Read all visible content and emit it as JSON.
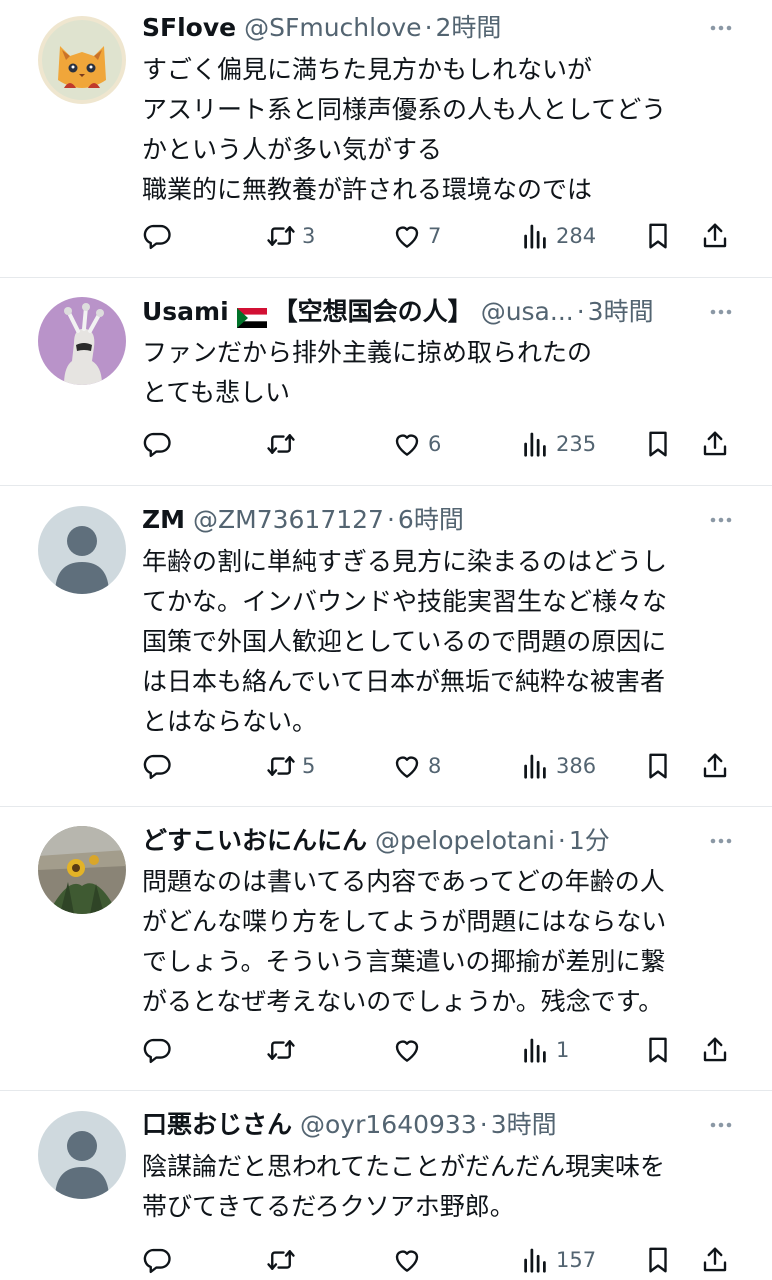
{
  "tweets": [
    {
      "name": "SFlove",
      "handle": "@SFmuchlove",
      "time": "2時間",
      "lines": [
        "すごく偏見に満ちた見方かもしれないが",
        "アスリート系と同様声優系の人も人としてどう",
        "かという人が多い気がする",
        "職業的に無教養が許される環境なのでは"
      ],
      "retweets": "3",
      "likes": "7",
      "views": "284",
      "avatar": "orange-cat-avatar"
    },
    {
      "name": "Usami",
      "name_extra": "【空想国会の人】",
      "handle": "@usa...",
      "time": "3時間",
      "lines": [
        "ファンだから排外主義に掠め取られたの",
        "とても悲しい"
      ],
      "retweets": "",
      "likes": "6",
      "views": "235",
      "avatar": "sculpture-avatar"
    },
    {
      "name": "ZM",
      "handle": "@ZM73617127",
      "time": "6時間",
      "lines": [
        "年齢の割に単純すぎる見方に染まるのはどうし",
        "てかな。インバウンドや技能実習生など様々な",
        "国策で外国人歓迎としているので問題の原因に",
        "は日本も絡んでいて日本が無垢で純粋な被害者",
        "とはならない。"
      ],
      "retweets": "5",
      "likes": "8",
      "views": "386",
      "avatar": "default-avatar"
    },
    {
      "name": "どすこいおにんにん",
      "handle": "@pelopelotani",
      "time": "1分",
      "lines": [
        "問題なのは書いてる内容であってどの年齢の人",
        "がどんな喋り方をしてようが問題にはならない",
        "でしょう。そういう言葉遣いの揶揄が差別に繋",
        "がるとなぜ考えないのでしょうか。残念です。"
      ],
      "retweets": "",
      "likes": "",
      "views": "1",
      "avatar": "sunflower-avatar"
    },
    {
      "name": "口悪おじさん",
      "handle": "@oyr1640933",
      "time": "3時間",
      "lines": [
        "陰謀論だと思われてたことがだんだん現実味を",
        "帯びてきてるだろクソアホ野郎。"
      ],
      "retweets": "",
      "likes": "",
      "views": "157",
      "avatar": "default-avatar"
    }
  ],
  "colors": {
    "text": "#0f1419",
    "secondary": "#536471",
    "divider": "#e6e9ec"
  },
  "icons": [
    "reply-icon",
    "retweet-icon",
    "like-icon",
    "views-icon",
    "bookmark-icon",
    "share-icon",
    "more-icon"
  ]
}
